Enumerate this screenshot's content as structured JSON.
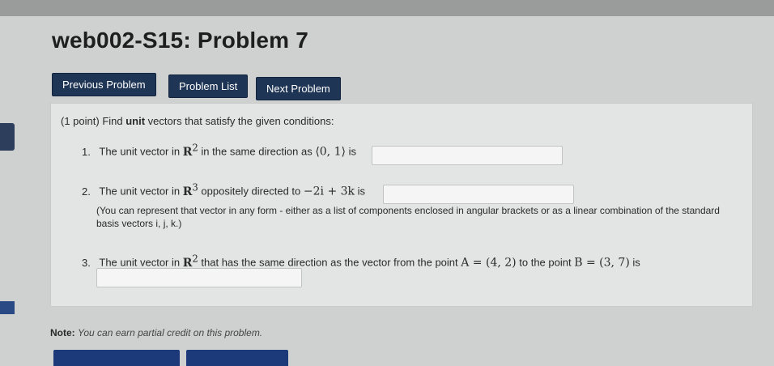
{
  "header": {
    "title": "web002-S15: Problem 7"
  },
  "nav": {
    "previous_label": "Previous Problem",
    "list_label": "Problem List",
    "next_label": "Next Problem"
  },
  "problem": {
    "points": "(1 point)",
    "intro_text": "Find ",
    "intro_bold": "unit",
    "intro_rest": " vectors that satisfy the given conditions:",
    "items": [
      {
        "number": "1.",
        "text_a": "The unit vector in ",
        "space": "R",
        "exp": "2",
        "text_b": " in the same direction as ",
        "vector": "⟨0, 1⟩",
        "text_c": " is",
        "answer_value": ""
      },
      {
        "number": "2.",
        "text_a": "The unit vector in ",
        "space": "R",
        "exp": "3",
        "text_b": " oppositely directed to ",
        "vector": "−2i + 3k",
        "text_c": " is",
        "answer_value": "",
        "note": "(You can represent that vector in any form - either as a list of components enclosed in angular brackets or as a linear combination of the standard basis vectors i, j, k.)"
      },
      {
        "number": "3.",
        "text_a": "The unit vector in ",
        "space": "R",
        "exp": "2",
        "text_b": " that has the same direction as the vector from the point ",
        "point_a": "A = (4, 2)",
        "text_c": " to the point ",
        "point_b": "B = (3, 7)",
        "text_d": " is",
        "answer_value": ""
      }
    ]
  },
  "footer": {
    "note_label": "Note:",
    "note_text": "You can earn partial credit on this problem."
  },
  "colors": {
    "button_bg": "#1f3556",
    "panel_bg": "#e3e5e4",
    "bottom_button_bg": "#1c3a7a"
  }
}
